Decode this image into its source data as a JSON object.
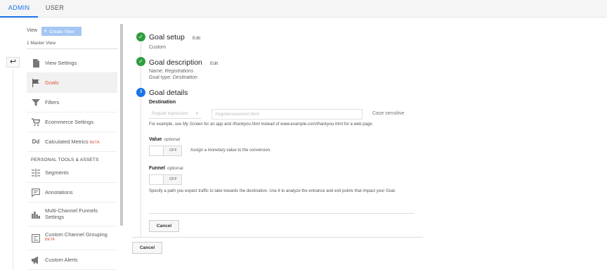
{
  "tabs": {
    "admin": "ADMIN",
    "user": "USER"
  },
  "sidebar": {
    "view_label": "View",
    "create_view": "Create View",
    "master_view": "1 Master View",
    "items": [
      {
        "label": "View Settings",
        "icon": "document-icon"
      },
      {
        "label": "Goals",
        "icon": "flag-icon"
      },
      {
        "label": "Filters",
        "icon": "filter-icon"
      },
      {
        "label": "Ecommerce Settings",
        "icon": "cart-icon"
      },
      {
        "label": "Calculated Metrics",
        "badge": "BETA",
        "icon": "dd-icon"
      }
    ],
    "section_title": "PERSONAL TOOLS & ASSETS",
    "tools": [
      {
        "label": "Segments",
        "icon": "segments-icon"
      },
      {
        "label": "Annotations",
        "icon": "annotation-icon"
      },
      {
        "label": "Multi-Channel Funnels Settings",
        "icon": "bar-chart-icon"
      },
      {
        "label": "Custom Channel Grouping",
        "badge": "BETA",
        "icon": "grouping-icon"
      },
      {
        "label": "Custom Alerts",
        "icon": "megaphone-icon"
      }
    ]
  },
  "goal": {
    "setup": {
      "title": "Goal setup",
      "edit": "Edit",
      "value": "Custom"
    },
    "description": {
      "title": "Goal description",
      "edit": "Edit",
      "name_label": "Name:",
      "name_value": "Registrations",
      "type_label": "Goal type:",
      "type_value": "Destination"
    },
    "details": {
      "step": "3",
      "title": "Goal details",
      "destination_label": "Destination",
      "match_type": "Regular expression",
      "destination_placeholder": "/registersuccess\\.html",
      "case_sensitive": "Case sensitive",
      "example_pre": "For example, use ",
      "example_my_screen": "My Screen",
      "example_mid1": " for an app and ",
      "example_thankyou": "/thankyou.html",
      "example_mid2": " instead of ",
      "example_url": "www.example.com/thankyou.html",
      "example_post": " for a web page.",
      "value_title": "Value",
      "value_optional": "optional",
      "value_toggle": "OFF",
      "value_desc": "Assign a monetary value to the conversion.",
      "funnel_title": "Funnel",
      "funnel_optional": "optional",
      "funnel_toggle": "OFF",
      "funnel_desc": "Specify a path you expect traffic to take towards the destination. Use it to analyze the entrance and exit points that impact your Goal.",
      "cancel": "Cancel"
    },
    "cancel": "Cancel"
  },
  "colors": {
    "accent": "#1a73e8",
    "active": "#e1553b",
    "done": "#2e9e3e"
  }
}
